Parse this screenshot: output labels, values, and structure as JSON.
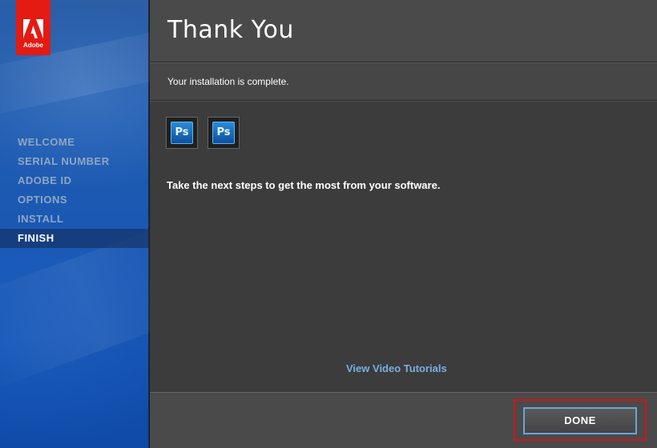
{
  "window": {
    "logo_text": "Adobe",
    "brand_color": "#e31b13",
    "accent_color": "#1f5bb0"
  },
  "sidebar": {
    "steps": [
      {
        "label": "WELCOME",
        "active": false
      },
      {
        "label": "SERIAL NUMBER",
        "active": false
      },
      {
        "label": "ADOBE ID",
        "active": false
      },
      {
        "label": "OPTIONS",
        "active": false
      },
      {
        "label": "INSTALL",
        "active": false
      },
      {
        "label": "FINISH",
        "active": true
      }
    ]
  },
  "header": {
    "title": "Thank You"
  },
  "subheader": {
    "status": "Your installation is complete."
  },
  "content": {
    "app_icons": [
      {
        "icon": "photoshop-icon",
        "label": "Ps"
      },
      {
        "icon": "photoshop-icon",
        "label": "Ps"
      }
    ],
    "next_steps": "Take the next steps to get the most from your software.",
    "video_link": "View Video Tutorials"
  },
  "footer": {
    "done_label": "DONE",
    "highlight_color": "#d0161b"
  }
}
